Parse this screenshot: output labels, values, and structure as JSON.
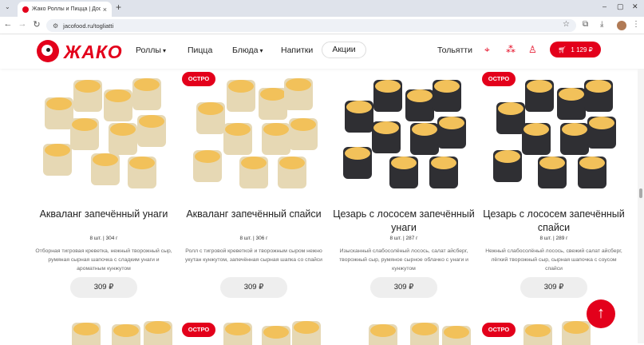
{
  "browser": {
    "tab_title": "Жако Роллы и Пицца | Доставка",
    "url": "jacofood.ru/togliatti",
    "new_tab": "+",
    "close_tab": "×"
  },
  "site": {
    "logo_text": "ЖАКО",
    "nav": [
      {
        "label": "Роллы",
        "has_dropdown": true
      },
      {
        "label": "Пицца",
        "has_dropdown": false
      },
      {
        "label": "Блюда",
        "has_dropdown": true
      },
      {
        "label": "Напитки",
        "has_dropdown": false
      },
      {
        "label": "Акции",
        "has_dropdown": false
      }
    ],
    "city": "Тольятти",
    "cart_total": "1 129 ₽",
    "accent_color": "#e3001b"
  },
  "products": [
    {
      "badge": "",
      "title": "Акваланг запечённый унаги",
      "count": "8 шт.",
      "weight": "304 г",
      "description": "Отборная тигровая креветка, нежный творожный сыр, румяная сырная шапочка с сладким унаги и ароматным кунжутом",
      "price": "309 ₽"
    },
    {
      "badge": "ОСТРО",
      "title": "Акваланг запечённый спайси",
      "count": "8 шт.",
      "weight": "306 г",
      "description": "Ролл с тигровой креветкой и творожным сыром нежно укутан кунжутом, запечённая сырная шапка со спайси",
      "price": "309 ₽"
    },
    {
      "badge": "",
      "title": "Цезарь с лососем запечённый унаги",
      "count": "8 шт.",
      "weight": "287 г",
      "description": "Изысканный слабосолёный лосось, салат айсберг, творожный сыр, румяное сырное облачко с унаги и кунжутом",
      "price": "309 ₽"
    },
    {
      "badge": "ОСТРО",
      "title": "Цезарь с лососем запечённый спайси",
      "count": "8 шт.",
      "weight": "289 г",
      "description": "Нежный слабосолёный лосось, свежий салат айсберг, лёгкий творожный сыр, сырная шапочка с соусом спайси",
      "price": "309 ₽"
    }
  ],
  "row2_badges": [
    "",
    "ОСТРО",
    "",
    "ОСТРО"
  ],
  "scroll_top_icon": "arrow-up"
}
